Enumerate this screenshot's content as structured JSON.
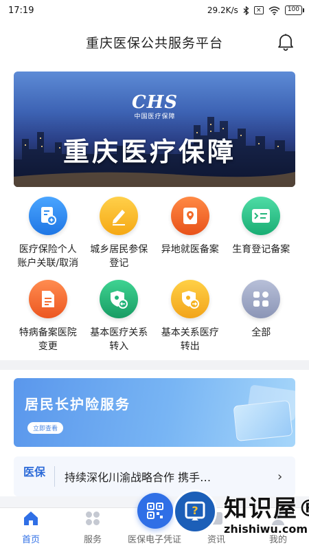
{
  "status_bar": {
    "time": "17:19",
    "speed": "29.2K/s",
    "battery": "100"
  },
  "header": {
    "title": "重庆医保公共服务平台"
  },
  "banner": {
    "logo_mark": "CHS",
    "logo_sub": "中国医疗保障",
    "title": "重庆医疗保障"
  },
  "services": [
    {
      "label": "医疗保险个人账户关联/取消",
      "icon": "account-link-icon",
      "color": "#2e8cf0"
    },
    {
      "label": "城乡居民参保登记",
      "icon": "edit-icon",
      "color": "#f7b924"
    },
    {
      "label": "异地就医备案",
      "icon": "location-icon",
      "color": "#f26b2a"
    },
    {
      "label": "生育登记备案",
      "icon": "id-card-icon",
      "color": "#2cc58d"
    },
    {
      "label": "特病备案医院变更",
      "icon": "document-icon",
      "color": "#f46d2f"
    },
    {
      "label": "基本医疗关系转入",
      "icon": "shield-in-icon",
      "color": "#22b57a"
    },
    {
      "label": "基本关系医疗转出",
      "icon": "shield-out-icon",
      "color": "#f5b322"
    },
    {
      "label": "全部",
      "icon": "grid-icon",
      "color": "#9aa4c4"
    }
  ],
  "ltc_banner": {
    "title": "居民长护险服务",
    "button": "立即查看"
  },
  "news": {
    "tag": "医保",
    "text": "持续深化川渝战略合作 携手…"
  },
  "tabs": [
    {
      "label": "首页",
      "icon": "home-icon",
      "active": true
    },
    {
      "label": "服务",
      "icon": "services-icon",
      "active": false
    },
    {
      "label": "医保电子凭证",
      "icon": "qr-code-icon",
      "active": false
    },
    {
      "label": "资讯",
      "icon": "news-icon",
      "active": false
    },
    {
      "label": "我的",
      "icon": "user-icon",
      "active": false
    }
  ],
  "watermark": {
    "brand": "知识屋®",
    "url": "zhishiwu.com"
  }
}
